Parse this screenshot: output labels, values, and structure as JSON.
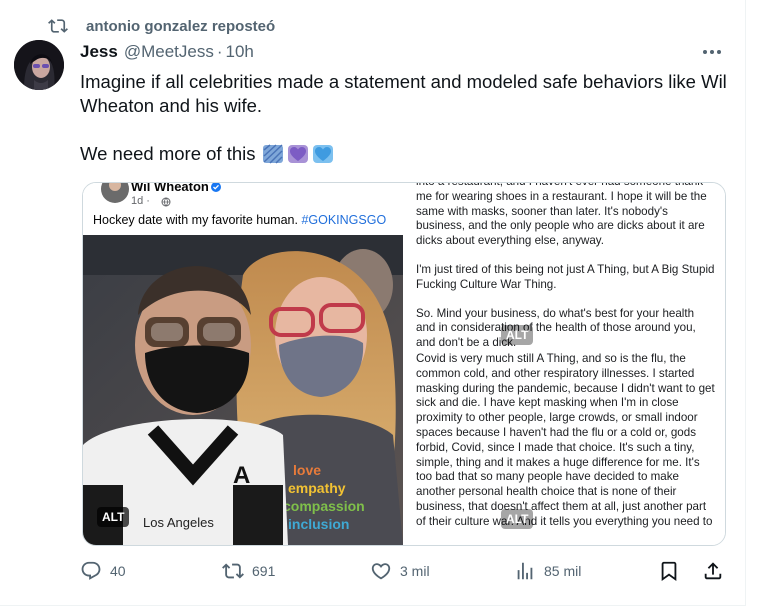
{
  "repost": {
    "text": "antonio gonzalez reposteó",
    "icon": "repost-icon"
  },
  "tweet": {
    "author_name": "Jess",
    "author_handle": "@MeetJess",
    "separator": "·",
    "time": "10h",
    "text_line1": "Imagine if all celebrities made a statement and modeled safe behaviors like Wil Wheaton and his wife.",
    "text_line2": "We need more of this",
    "emoji_hearts": [
      "blue-pattern-heart-icon",
      "purple-heart-icon",
      "blue-heart-icon"
    ]
  },
  "media": {
    "left": {
      "fb_name": "Wil Wheaton",
      "fb_time": "1d ·",
      "caption": "Hockey date with my favorite human.",
      "hashtag": "#GOKINGSGO",
      "jersey_text": "Los Angeles",
      "shirt_text": "love empathy compassion inclusion justice kindness",
      "alt": "ALT"
    },
    "right": {
      "paragraph1": "into a restaurant, and I haven't ever had someone thank me for wearing shoes in a restaurant. I hope it will be the same with masks, sooner than later. It's nobody's business, and the only people who are dicks about it are dicks about everything else, anyway.",
      "paragraph2": "I'm just tired of this being not just A Thing, but A Big Stupid Fucking Culture War Thing.",
      "paragraph3": "So. Mind your business, do what's best for your health and in consideration of the health of those around you, and don't be a dick.",
      "paragraph4": "Covid is very much still A Thing, and so is the flu, the common cold, and other respiratory illnesses. I started masking during the pandemic, because I didn't want to get sick and die. I have kept masking when I'm in close proximity to other people, large crowds, or small indoor spaces because I haven't had the flu or a cold or, gods forbid, Covid, since I made that choice. It's such a tiny, simple, thing and it makes a huge difference for me. It's too bad that so many people have decided to make another personal health choice that is none of their business, that doesn't affect them at all, just another part of their culture war. And it tells you everything you need to",
      "alt_top": "ALT",
      "alt_bottom": "ALT"
    }
  },
  "actions": {
    "replies": "40",
    "reposts": "691",
    "likes": "3 mil",
    "views": "85 mil"
  },
  "colors": {
    "accent_text": "#536471",
    "link": "#216fdb",
    "border": "#cfd9de"
  }
}
